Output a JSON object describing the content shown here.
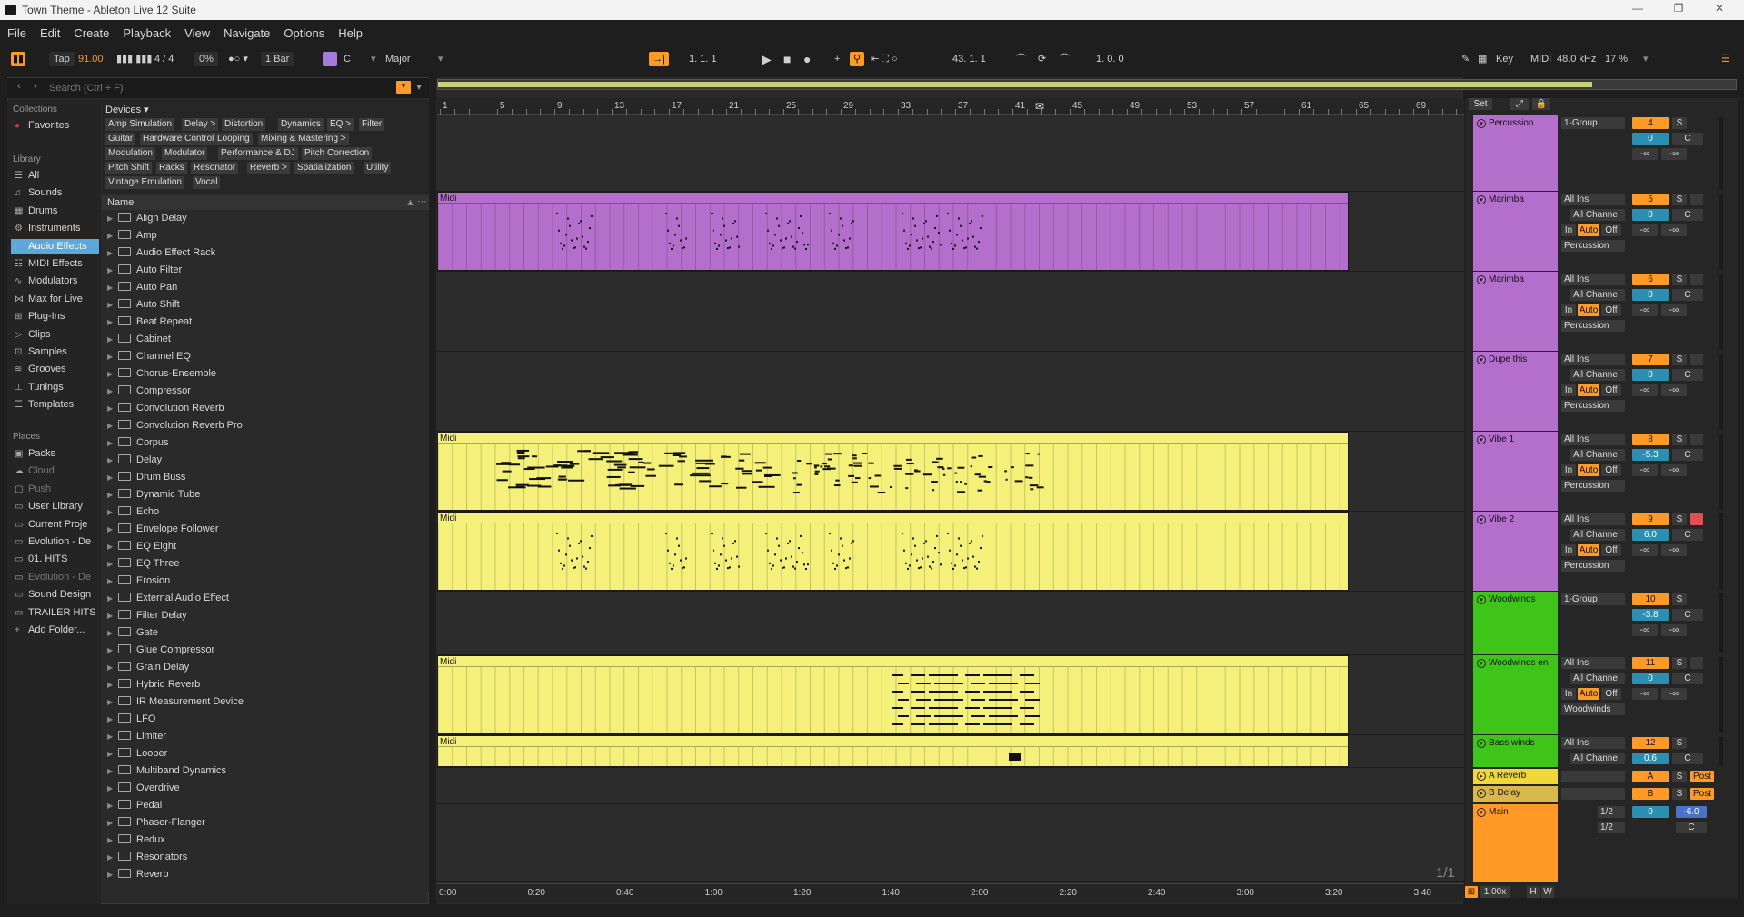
{
  "window": {
    "title": "Town Theme - Ableton Live 12 Suite",
    "minimize": "—",
    "maximize": "❐",
    "close": "✕"
  },
  "menu": [
    "File",
    "Edit",
    "Create",
    "Playback",
    "View",
    "Navigate",
    "Options",
    "Help"
  ],
  "transport": {
    "tap": "Tap",
    "tempo": "91.00",
    "time_signature": "4 / 4",
    "groove": "0%",
    "quantize": "1 Bar",
    "key": "C",
    "scale": "Major",
    "position": "1.   1.   1",
    "loop_start": "43.   1.   1",
    "loop_length": "1.   0.   0",
    "key_label": "Key",
    "midi_label": "MIDI",
    "sample_rate": "48.0 kHz",
    "cpu": "17 %"
  },
  "browser": {
    "search_placeholder": "Search (Ctrl + F)",
    "collections_title": "Collections",
    "favorites": "Favorites",
    "library_title": "Library",
    "library_items": [
      {
        "label": "All",
        "icon": "☰"
      },
      {
        "label": "Sounds",
        "icon": "♫"
      },
      {
        "label": "Drums",
        "icon": "▦"
      },
      {
        "label": "Instruments",
        "icon": "⚙"
      },
      {
        "label": "Audio Effects",
        "icon": "⫶"
      },
      {
        "label": "MIDI Effects",
        "icon": "☷"
      },
      {
        "label": "Modulators",
        "icon": "∿"
      },
      {
        "label": "Max for Live",
        "icon": "⋈"
      },
      {
        "label": "Plug-Ins",
        "icon": "⊞"
      },
      {
        "label": "Clips",
        "icon": "▷"
      },
      {
        "label": "Samples",
        "icon": "⊡"
      },
      {
        "label": "Grooves",
        "icon": "≋"
      },
      {
        "label": "Tunings",
        "icon": "⊥"
      },
      {
        "label": "Templates",
        "icon": "☰"
      }
    ],
    "places_title": "Places",
    "places_items": [
      {
        "label": "Packs",
        "icon": "▣"
      },
      {
        "label": "Cloud",
        "icon": "☁"
      },
      {
        "label": "Push",
        "icon": "▢"
      },
      {
        "label": "User Library",
        "icon": "▭"
      },
      {
        "label": "Current Proje",
        "icon": "▭"
      },
      {
        "label": "Evolution - De",
        "icon": "▭"
      },
      {
        "label": "01. HITS",
        "icon": "▭"
      },
      {
        "label": "Evolution - De",
        "icon": "▭"
      },
      {
        "label": "Sound Design",
        "icon": "▭"
      },
      {
        "label": "TRAILER HITS",
        "icon": "▭"
      },
      {
        "label": "Add Folder...",
        "icon": "+"
      }
    ],
    "devices_title": "Devices",
    "device_tags": [
      "Amp Simulation",
      "Delay >",
      "Distortion",
      "Dynamics",
      "EQ >",
      "Filter",
      "Guitar",
      "Hardware Control",
      "Looping",
      "Mixing & Mastering >",
      "Modulation",
      "Modulator",
      "Performance & DJ",
      "Pitch Correction",
      "Pitch Shift",
      "Racks",
      "Resonator",
      "Reverb >",
      "Spatialization",
      "Utility",
      "Vintage Emulation",
      "Vocal"
    ],
    "list_header": "Name",
    "files": [
      "Align Delay",
      "Amp",
      "Audio Effect Rack",
      "Auto Filter",
      "Auto Pan",
      "Auto Shift",
      "Beat Repeat",
      "Cabinet",
      "Channel EQ",
      "Chorus-Ensemble",
      "Compressor",
      "Convolution Reverb",
      "Convolution Reverb Pro",
      "Corpus",
      "Delay",
      "Drum Buss",
      "Dynamic Tube",
      "Echo",
      "Envelope Follower",
      "EQ Eight",
      "EQ Three",
      "Erosion",
      "External Audio Effect",
      "Filter Delay",
      "Gate",
      "Glue Compressor",
      "Grain Delay",
      "Hybrid Reverb",
      "IR Measurement Device",
      "LFO",
      "Limiter",
      "Looper",
      "Multiband Dynamics",
      "Overdrive",
      "Pedal",
      "Phaser-Flanger",
      "Redux",
      "Resonators",
      "Reverb"
    ]
  },
  "arrangement": {
    "bar_numbers": [
      "1",
      "5",
      "9",
      "13",
      "17",
      "21",
      "25",
      "29",
      "33",
      "37",
      "41",
      "45",
      "49",
      "53",
      "57",
      "61",
      "65",
      "69"
    ],
    "time_labels": [
      "0:00",
      "0:20",
      "0:40",
      "1:00",
      "1:20",
      "1:40",
      "2:00",
      "2:20",
      "2:40",
      "3:00",
      "3:20",
      "3:40"
    ],
    "clip_label": "Midi",
    "pager": "1/1",
    "set_label": "Set"
  },
  "tracks": [
    {
      "name": "Percussion",
      "input": "1-Group",
      "number": "4",
      "volume": "0",
      "pan": "C",
      "peak_l": "-∞",
      "peak_r": "-∞",
      "color": "#b46fcc"
    },
    {
      "name": "Marimba",
      "input": "All Ins",
      "channel": "All Channe",
      "number": "5",
      "volume": "0",
      "pan": "C",
      "peak_l": "-∞",
      "peak_r": "-∞",
      "monitor": [
        "In",
        "Auto",
        "Off"
      ],
      "output": "Percussion",
      "color": "#b46fcc"
    },
    {
      "name": "Marimba",
      "input": "All Ins",
      "channel": "All Channe",
      "number": "6",
      "volume": "0",
      "pan": "C",
      "peak_l": "-∞",
      "peak_r": "-∞",
      "monitor": [
        "In",
        "Auto",
        "Off"
      ],
      "output": "Percussion",
      "color": "#b46fcc"
    },
    {
      "name": "Dupe this",
      "input": "All Ins",
      "channel": "All Channe",
      "number": "7",
      "volume": "0",
      "pan": "C",
      "peak_l": "-∞",
      "peak_r": "-∞",
      "monitor": [
        "In",
        "Auto",
        "Off"
      ],
      "output": "Percussion",
      "color": "#b46fcc"
    },
    {
      "name": "Vibe 1",
      "input": "All Ins",
      "channel": "All Channe",
      "number": "8",
      "volume": "-5.3",
      "pan": "C",
      "peak_l": "-∞",
      "peak_r": "-∞",
      "monitor": [
        "In",
        "Auto",
        "Off"
      ],
      "output": "Percussion",
      "color": "#b46fcc"
    },
    {
      "name": "Vibe 2",
      "input": "All Ins",
      "channel": "All Channe",
      "number": "9",
      "volume": "6.0",
      "pan": "C",
      "peak_l": "-∞",
      "peak_r": "-∞",
      "monitor": [
        "In",
        "Auto",
        "Off"
      ],
      "output": "Percussion",
      "color": "#b46fcc"
    },
    {
      "name": "Woodwinds",
      "input": "1-Group",
      "number": "10",
      "volume": "-3.8",
      "pan": "C",
      "peak_l": "-∞",
      "peak_r": "-∞",
      "color": "#3fc41a"
    },
    {
      "name": "Woodwinds en",
      "input": "All Ins",
      "channel": "All Channe",
      "number": "11",
      "volume": "0",
      "pan": "C",
      "peak_l": "-∞",
      "peak_r": "-∞",
      "monitor": [
        "In",
        "Auto",
        "Off"
      ],
      "output": "Woodwinds",
      "color": "#3fc41a"
    },
    {
      "name": "Bass winds",
      "input": "All Ins",
      "channel": "All Channe",
      "number": "12",
      "volume": "0.6",
      "pan": "C",
      "color": "#3fc41a"
    }
  ],
  "returns": [
    {
      "name": "A Reverb",
      "letter": "A",
      "post": "Post",
      "color": "#f0d83a"
    },
    {
      "name": "B Delay",
      "letter": "B",
      "post": "Post",
      "color": "#d8b84a"
    }
  ],
  "main": {
    "name": "Main",
    "out1": "1/2",
    "out2": "1/2",
    "number": "0",
    "volume": "-6.0",
    "pan": "C",
    "color": "#ff9a26"
  },
  "solo_label": "S",
  "zoom": "1.00x",
  "h_label": "H",
  "w_label": "W",
  "colors": {
    "accent": "#ff9a26",
    "clip_yellow": "#f4f07a",
    "clip_purple": "#b46fcc",
    "group_green": "#3fc41a",
    "selected_blue": "#5da8d9"
  }
}
